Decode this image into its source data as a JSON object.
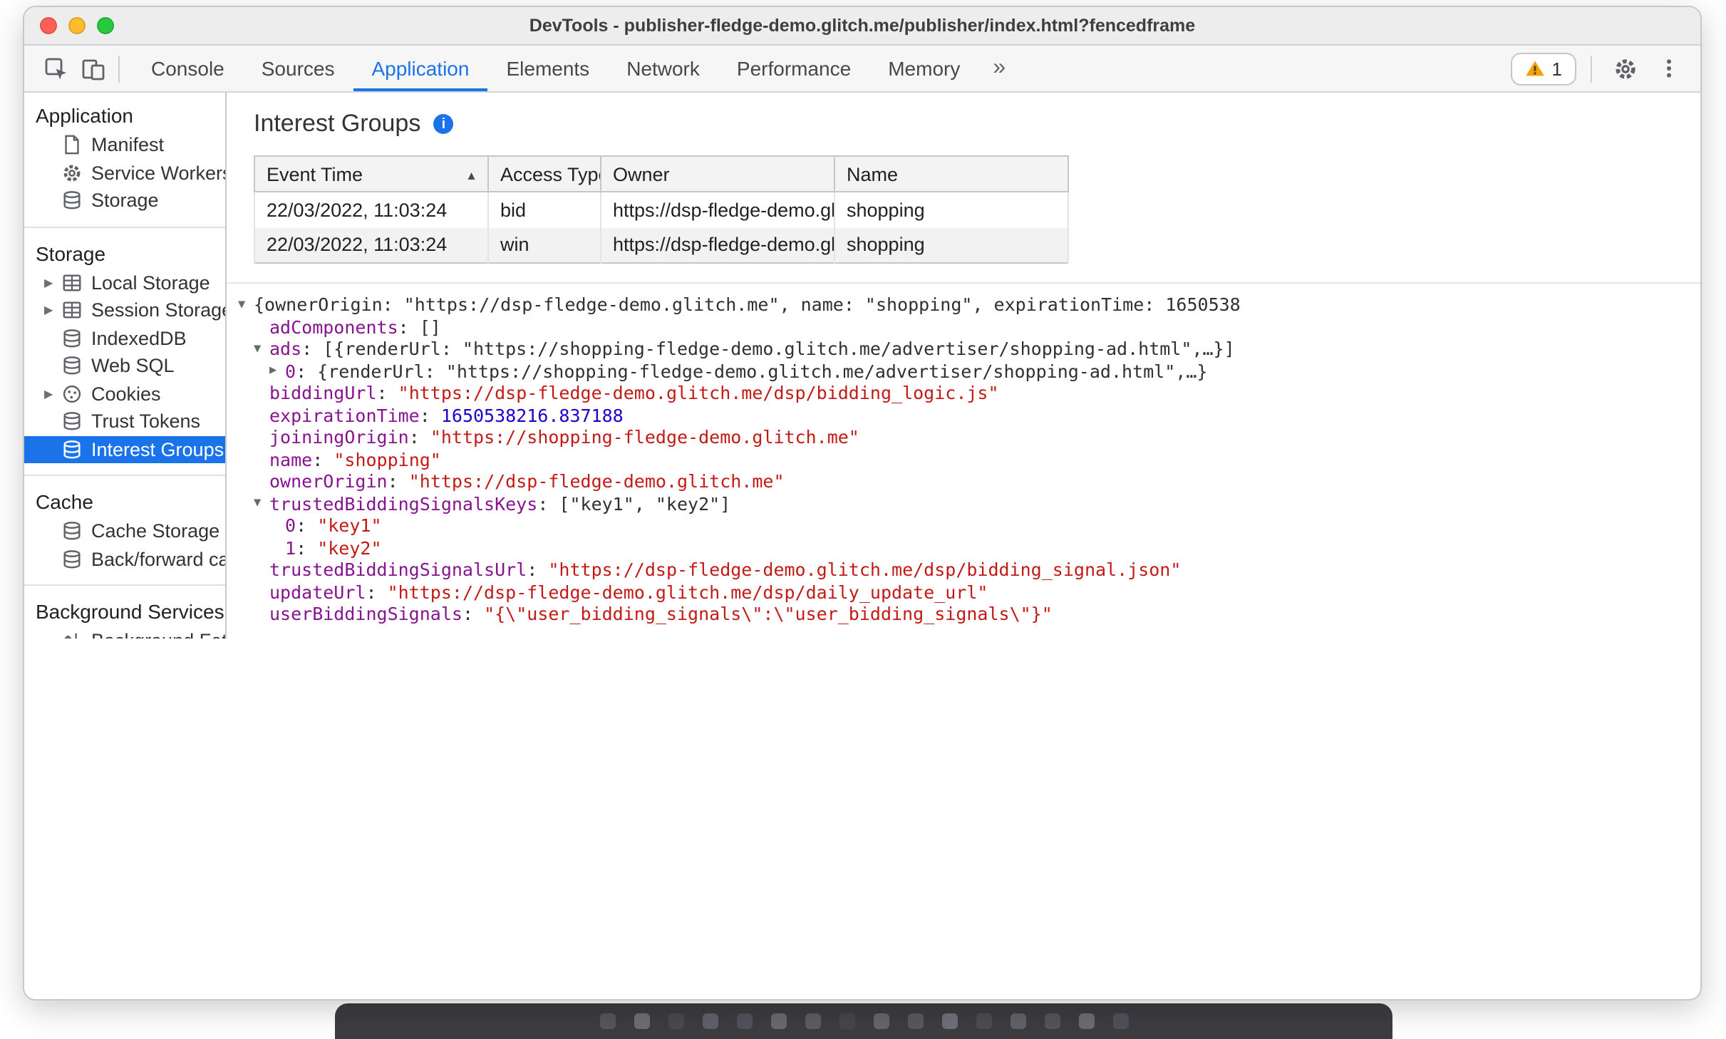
{
  "colors": {
    "accent_blue": "#1a73e8",
    "selected_row_bg": "#1a73e8",
    "json_key": "#881391",
    "json_string": "#c41a16",
    "json_number": "#1c00cf",
    "warning_yellow": "#f0a30a",
    "traffic_red": "#ff5f57",
    "traffic_yellow": "#febc2e",
    "traffic_green": "#28c840"
  },
  "window": {
    "title": "DevTools - publisher-fledge-demo.glitch.me/publisher/index.html?fencedframe",
    "traffic_lights": [
      "close",
      "minimize",
      "zoom"
    ]
  },
  "toolbar": {
    "left_icons": [
      "inspect-icon",
      "device-toolbar-icon"
    ],
    "tabs": [
      {
        "label": "Console"
      },
      {
        "label": "Sources"
      },
      {
        "label": "Application",
        "active": true
      },
      {
        "label": "Elements"
      },
      {
        "label": "Network"
      },
      {
        "label": "Performance"
      },
      {
        "label": "Memory"
      }
    ],
    "more_tabs_icon": "»",
    "warning": {
      "count": "1",
      "icon": "warning-icon"
    },
    "right_icons": [
      "settings-gear-icon",
      "kebab-menu-icon"
    ]
  },
  "sidebar": {
    "sections": [
      {
        "title": "Application",
        "items": [
          {
            "label": "Manifest",
            "icon": "manifest-icon"
          },
          {
            "label": "Service Workers",
            "icon": "service-workers-icon"
          },
          {
            "label": "Storage",
            "icon": "database-icon"
          }
        ]
      },
      {
        "title": "Storage",
        "items": [
          {
            "label": "Local Storage",
            "icon": "table-icon",
            "expander": true
          },
          {
            "label": "Session Storage",
            "icon": "table-icon",
            "expander": true
          },
          {
            "label": "IndexedDB",
            "icon": "database-icon"
          },
          {
            "label": "Web SQL",
            "icon": "database-icon"
          },
          {
            "label": "Cookies",
            "icon": "cookie-icon",
            "expander": true
          },
          {
            "label": "Trust Tokens",
            "icon": "database-icon"
          },
          {
            "label": "Interest Groups",
            "icon": "database-icon",
            "selected": true
          }
        ]
      },
      {
        "title": "Cache",
        "items": [
          {
            "label": "Cache Storage",
            "icon": "database-icon"
          },
          {
            "label": "Back/forward cach",
            "icon": "database-icon"
          }
        ]
      },
      {
        "title": "Background Services",
        "items": [
          {
            "label": "Background Fetch",
            "icon": "background-fetch-icon"
          }
        ]
      }
    ]
  },
  "main": {
    "title": "Interest Groups",
    "info_icon": "info-icon",
    "table": {
      "columns": [
        {
          "label": "Event Time",
          "sort": "asc"
        },
        {
          "label": "Access Type"
        },
        {
          "label": "Owner"
        },
        {
          "label": "Name"
        }
      ],
      "rows": [
        [
          "22/03/2022, 11:03:24",
          "bid",
          "https://dsp-fledge-demo.gl…",
          "shopping"
        ],
        [
          "22/03/2022, 11:03:24",
          "win",
          "https://dsp-fledge-demo.gl…",
          "shopping"
        ]
      ]
    },
    "tree": {
      "lines": [
        {
          "level": 0,
          "marker": "expanded",
          "tokens": [
            {
              "c": "plain",
              "t": "{ownerOrigin: \"https://dsp-fledge-demo.glitch.me\", name: \"shopping\", expirationTime: 1650538"
            }
          ]
        },
        {
          "level": 1,
          "marker": null,
          "tokens": [
            {
              "c": "key",
              "t": "adComponents"
            },
            {
              "c": "plain",
              "t": ": []"
            }
          ]
        },
        {
          "level": 1,
          "marker": "expanded",
          "tokens": [
            {
              "c": "key",
              "t": "ads"
            },
            {
              "c": "plain",
              "t": ": [{renderUrl: \"https://shopping-fledge-demo.glitch.me/advertiser/shopping-ad.html\",…}]"
            }
          ]
        },
        {
          "level": 2,
          "marker": "collapsed",
          "tokens": [
            {
              "c": "key",
              "t": "0"
            },
            {
              "c": "plain",
              "t": ": {renderUrl: \"https://shopping-fledge-demo.glitch.me/advertiser/shopping-ad.html\",…}"
            }
          ]
        },
        {
          "level": 1,
          "marker": null,
          "tokens": [
            {
              "c": "key",
              "t": "biddingUrl"
            },
            {
              "c": "plain",
              "t": ": "
            },
            {
              "c": "str",
              "t": "\"https://dsp-fledge-demo.glitch.me/dsp/bidding_logic.js\""
            }
          ]
        },
        {
          "level": 1,
          "marker": null,
          "tokens": [
            {
              "c": "key",
              "t": "expirationTime"
            },
            {
              "c": "plain",
              "t": ": "
            },
            {
              "c": "num",
              "t": "1650538216.837188"
            }
          ]
        },
        {
          "level": 1,
          "marker": null,
          "tokens": [
            {
              "c": "key",
              "t": "joiningOrigin"
            },
            {
              "c": "plain",
              "t": ": "
            },
            {
              "c": "str",
              "t": "\"https://shopping-fledge-demo.glitch.me\""
            }
          ]
        },
        {
          "level": 1,
          "marker": null,
          "tokens": [
            {
              "c": "key",
              "t": "name"
            },
            {
              "c": "plain",
              "t": ": "
            },
            {
              "c": "str",
              "t": "\"shopping\""
            }
          ]
        },
        {
          "level": 1,
          "marker": null,
          "tokens": [
            {
              "c": "key",
              "t": "ownerOrigin"
            },
            {
              "c": "plain",
              "t": ": "
            },
            {
              "c": "str",
              "t": "\"https://dsp-fledge-demo.glitch.me\""
            }
          ]
        },
        {
          "level": 1,
          "marker": "expanded",
          "tokens": [
            {
              "c": "key",
              "t": "trustedBiddingSignalsKeys"
            },
            {
              "c": "plain",
              "t": ": [\"key1\", \"key2\"]"
            }
          ]
        },
        {
          "level": 2,
          "marker": null,
          "tokens": [
            {
              "c": "key",
              "t": "0"
            },
            {
              "c": "plain",
              "t": ": "
            },
            {
              "c": "str",
              "t": "\"key1\""
            }
          ]
        },
        {
          "level": 2,
          "marker": null,
          "tokens": [
            {
              "c": "key",
              "t": "1"
            },
            {
              "c": "plain",
              "t": ": "
            },
            {
              "c": "str",
              "t": "\"key2\""
            }
          ]
        },
        {
          "level": 1,
          "marker": null,
          "tokens": [
            {
              "c": "key",
              "t": "trustedBiddingSignalsUrl"
            },
            {
              "c": "plain",
              "t": ": "
            },
            {
              "c": "str",
              "t": "\"https://dsp-fledge-demo.glitch.me/dsp/bidding_signal.json\""
            }
          ]
        },
        {
          "level": 1,
          "marker": null,
          "tokens": [
            {
              "c": "key",
              "t": "updateUrl"
            },
            {
              "c": "plain",
              "t": ": "
            },
            {
              "c": "str",
              "t": "\"https://dsp-fledge-demo.glitch.me/dsp/daily_update_url\""
            }
          ]
        },
        {
          "level": 1,
          "marker": null,
          "tokens": [
            {
              "c": "key",
              "t": "userBiddingSignals"
            },
            {
              "c": "plain",
              "t": ": "
            },
            {
              "c": "str",
              "t": "\"{\\\"user_bidding_signals\\\":\\\"user_bidding_signals\\\"}\""
            }
          ]
        }
      ]
    }
  }
}
